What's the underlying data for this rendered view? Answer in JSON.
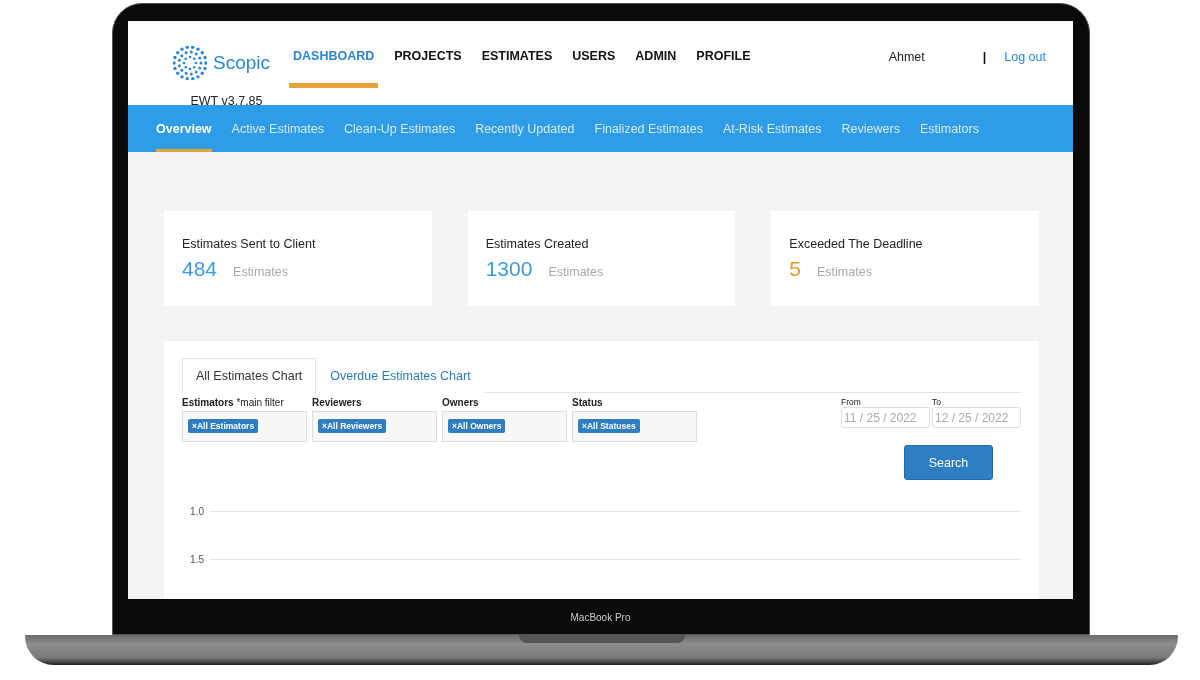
{
  "brand": {
    "name": "Scopic",
    "version": "EWT v3.7.85"
  },
  "nav": [
    {
      "label": "DASHBOARD",
      "selected": true
    },
    {
      "label": "PROJECTS",
      "selected": false
    },
    {
      "label": "ESTIMATES",
      "selected": false
    },
    {
      "label": "USERS",
      "selected": false
    },
    {
      "label": "ADMIN",
      "selected": false
    },
    {
      "label": "PROFILE",
      "selected": false
    }
  ],
  "user": {
    "name": "Ahmet",
    "separator": "|",
    "logout": "Log out"
  },
  "subnav": [
    {
      "label": "Overview",
      "selected": true
    },
    {
      "label": "Active Estimates",
      "selected": false
    },
    {
      "label": "Clean-Up Estimates",
      "selected": false
    },
    {
      "label": "Recently Updated",
      "selected": false
    },
    {
      "label": "Finalized Estimates",
      "selected": false
    },
    {
      "label": "At-Risk Estimates",
      "selected": false
    },
    {
      "label": "Reviewers",
      "selected": false
    },
    {
      "label": "Estimators",
      "selected": false
    }
  ],
  "stats": [
    {
      "title": "Estimates Sent to Client",
      "value": "484",
      "unit": "Estimates",
      "color": "#3d9be0"
    },
    {
      "title": "Estimates Created",
      "value": "1300",
      "unit": "Estimates",
      "color": "#3d9be0"
    },
    {
      "title": "Exceeded The Deadline",
      "value": "5",
      "unit": "Estimates",
      "color": "#e39a32"
    }
  ],
  "chart_tabs": [
    {
      "label": "All Estimates Chart",
      "selected": true
    },
    {
      "label": "Overdue Estimates Chart",
      "selected": false
    }
  ],
  "filters": [
    {
      "label": "Estimators",
      "note": "*main filter",
      "tag": "All Estimators"
    },
    {
      "label": "Reviewers",
      "tag": "All Reviewers"
    },
    {
      "label": "Owners",
      "tag": "All Owners"
    },
    {
      "label": "Status",
      "tag": "All Statuses"
    }
  ],
  "tag_remove": "×",
  "dates": [
    {
      "label": "From",
      "value": "11 / 25 / 2022"
    },
    {
      "label": "To",
      "value": "12 / 25 / 2022"
    }
  ],
  "search_button": "Search",
  "chart_axis_labels": [
    "1.0",
    "1.5"
  ],
  "device_label": "MacBook Pro"
}
